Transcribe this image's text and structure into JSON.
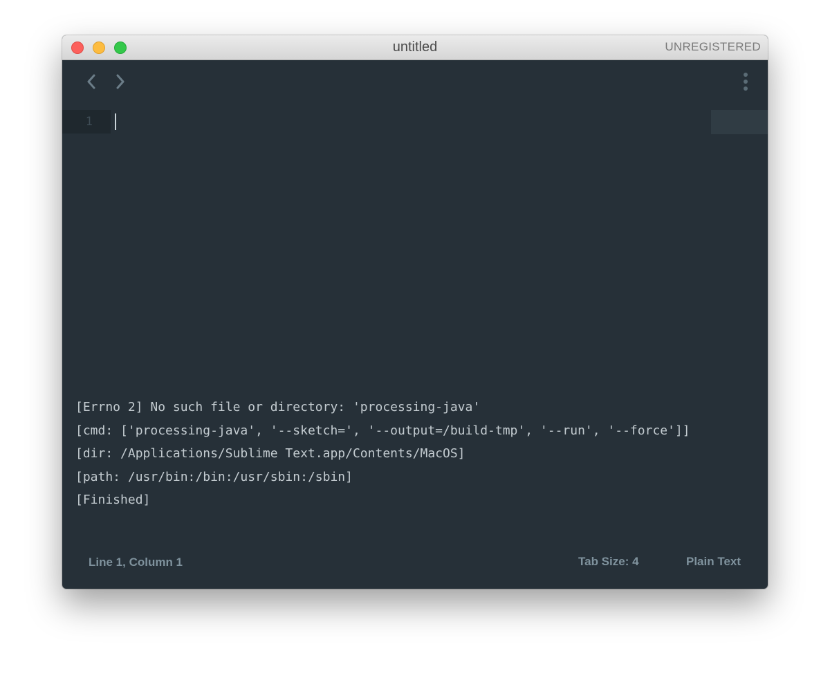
{
  "window": {
    "title": "untitled",
    "license_label": "UNREGISTERED"
  },
  "navigation": {
    "back_icon": "chevron-left-icon",
    "forward_icon": "chevron-right-icon",
    "more_icon": "vertical-ellipsis-icon"
  },
  "editor": {
    "line_numbers": [
      "1"
    ],
    "content": ""
  },
  "output_panel": {
    "lines": [
      "[Errno 2] No such file or directory: 'processing-java'",
      "[cmd: ['processing-java', '--sketch=', '--output=/build-tmp', '--run', '--force']]",
      "[dir: /Applications/Sublime Text.app/Contents/MacOS]",
      "[path: /usr/bin:/bin:/usr/sbin:/sbin]",
      "[Finished]"
    ]
  },
  "status_bar": {
    "position": "Line 1, Column 1",
    "tab_size": "Tab Size: 4",
    "syntax": "Plain Text"
  },
  "colors": {
    "editor_background": "#263038",
    "close_button": "#fc605c",
    "minimize_button": "#fdbc40",
    "maximize_button": "#34c84a",
    "output_text": "#c3cbd0",
    "status_text": "#7f929d"
  }
}
